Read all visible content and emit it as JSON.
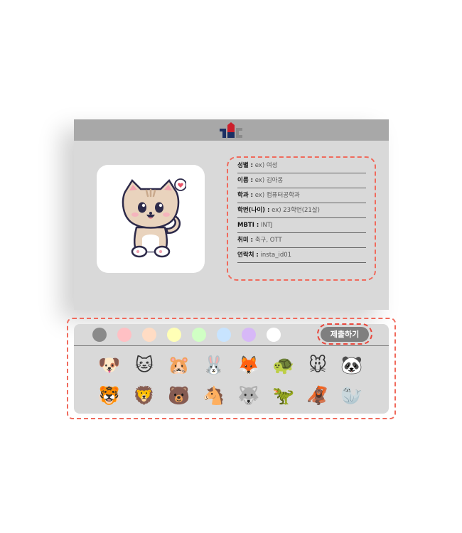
{
  "profile": {
    "rows": [
      {
        "key": "성별 :",
        "value": "ex) 여성"
      },
      {
        "key": "이름 :",
        "value": "ex) 김아옹"
      },
      {
        "key": "학과 :",
        "value": "ex) 컴퓨터공학과"
      },
      {
        "key": "학번(나이) :",
        "value": "ex) 23학번(21살)"
      },
      {
        "key": "MBTI :",
        "value": "INTJ"
      },
      {
        "key": "취미 :",
        "value": "축구, OTT"
      },
      {
        "key": "연락처 :",
        "value": "insta_id01"
      }
    ]
  },
  "colors": {
    "swatches": [
      "#8a8a8a",
      "#ffc0c4",
      "#ffdcc4",
      "#ffffb6",
      "#d0ffc4",
      "#c8e4ff",
      "#d7b8f7",
      "#ffffff"
    ],
    "frame": "#f06a5c",
    "logo_red": "#cc1f2b",
    "logo_navy": "#1c2f63",
    "logo_gray": "#8a8a8a"
  },
  "actions": {
    "submit_label": "제출하기"
  },
  "animals": {
    "row1": [
      "dog-face",
      "cat-face",
      "hamster-face",
      "rabbit-face",
      "fox-face",
      "turtle",
      "mouse-face",
      "panda-face"
    ],
    "row2": [
      "tiger-face",
      "lion-face",
      "bear-face",
      "horse-face",
      "wolf-face",
      "t-rex",
      "orangutan",
      "seal"
    ]
  }
}
